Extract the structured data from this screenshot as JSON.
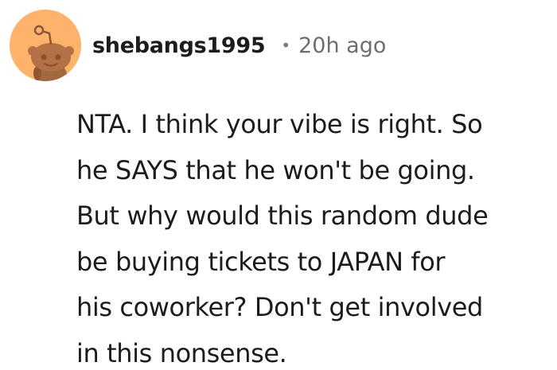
{
  "comment": {
    "username": "shebangs1995",
    "separator": "•",
    "timestamp": "20h ago",
    "avatar_icon": "snoo-avatar-icon",
    "avatar_color": "#fdb36b",
    "body_lines": [
      "NTA. I think your vibe is right. So",
      "he SAYS that he won't be going.",
      "But why would this random dude",
      "be buying tickets to JAPAN for",
      "his coworker? Don't get involved",
      "in this nonsense."
    ]
  }
}
